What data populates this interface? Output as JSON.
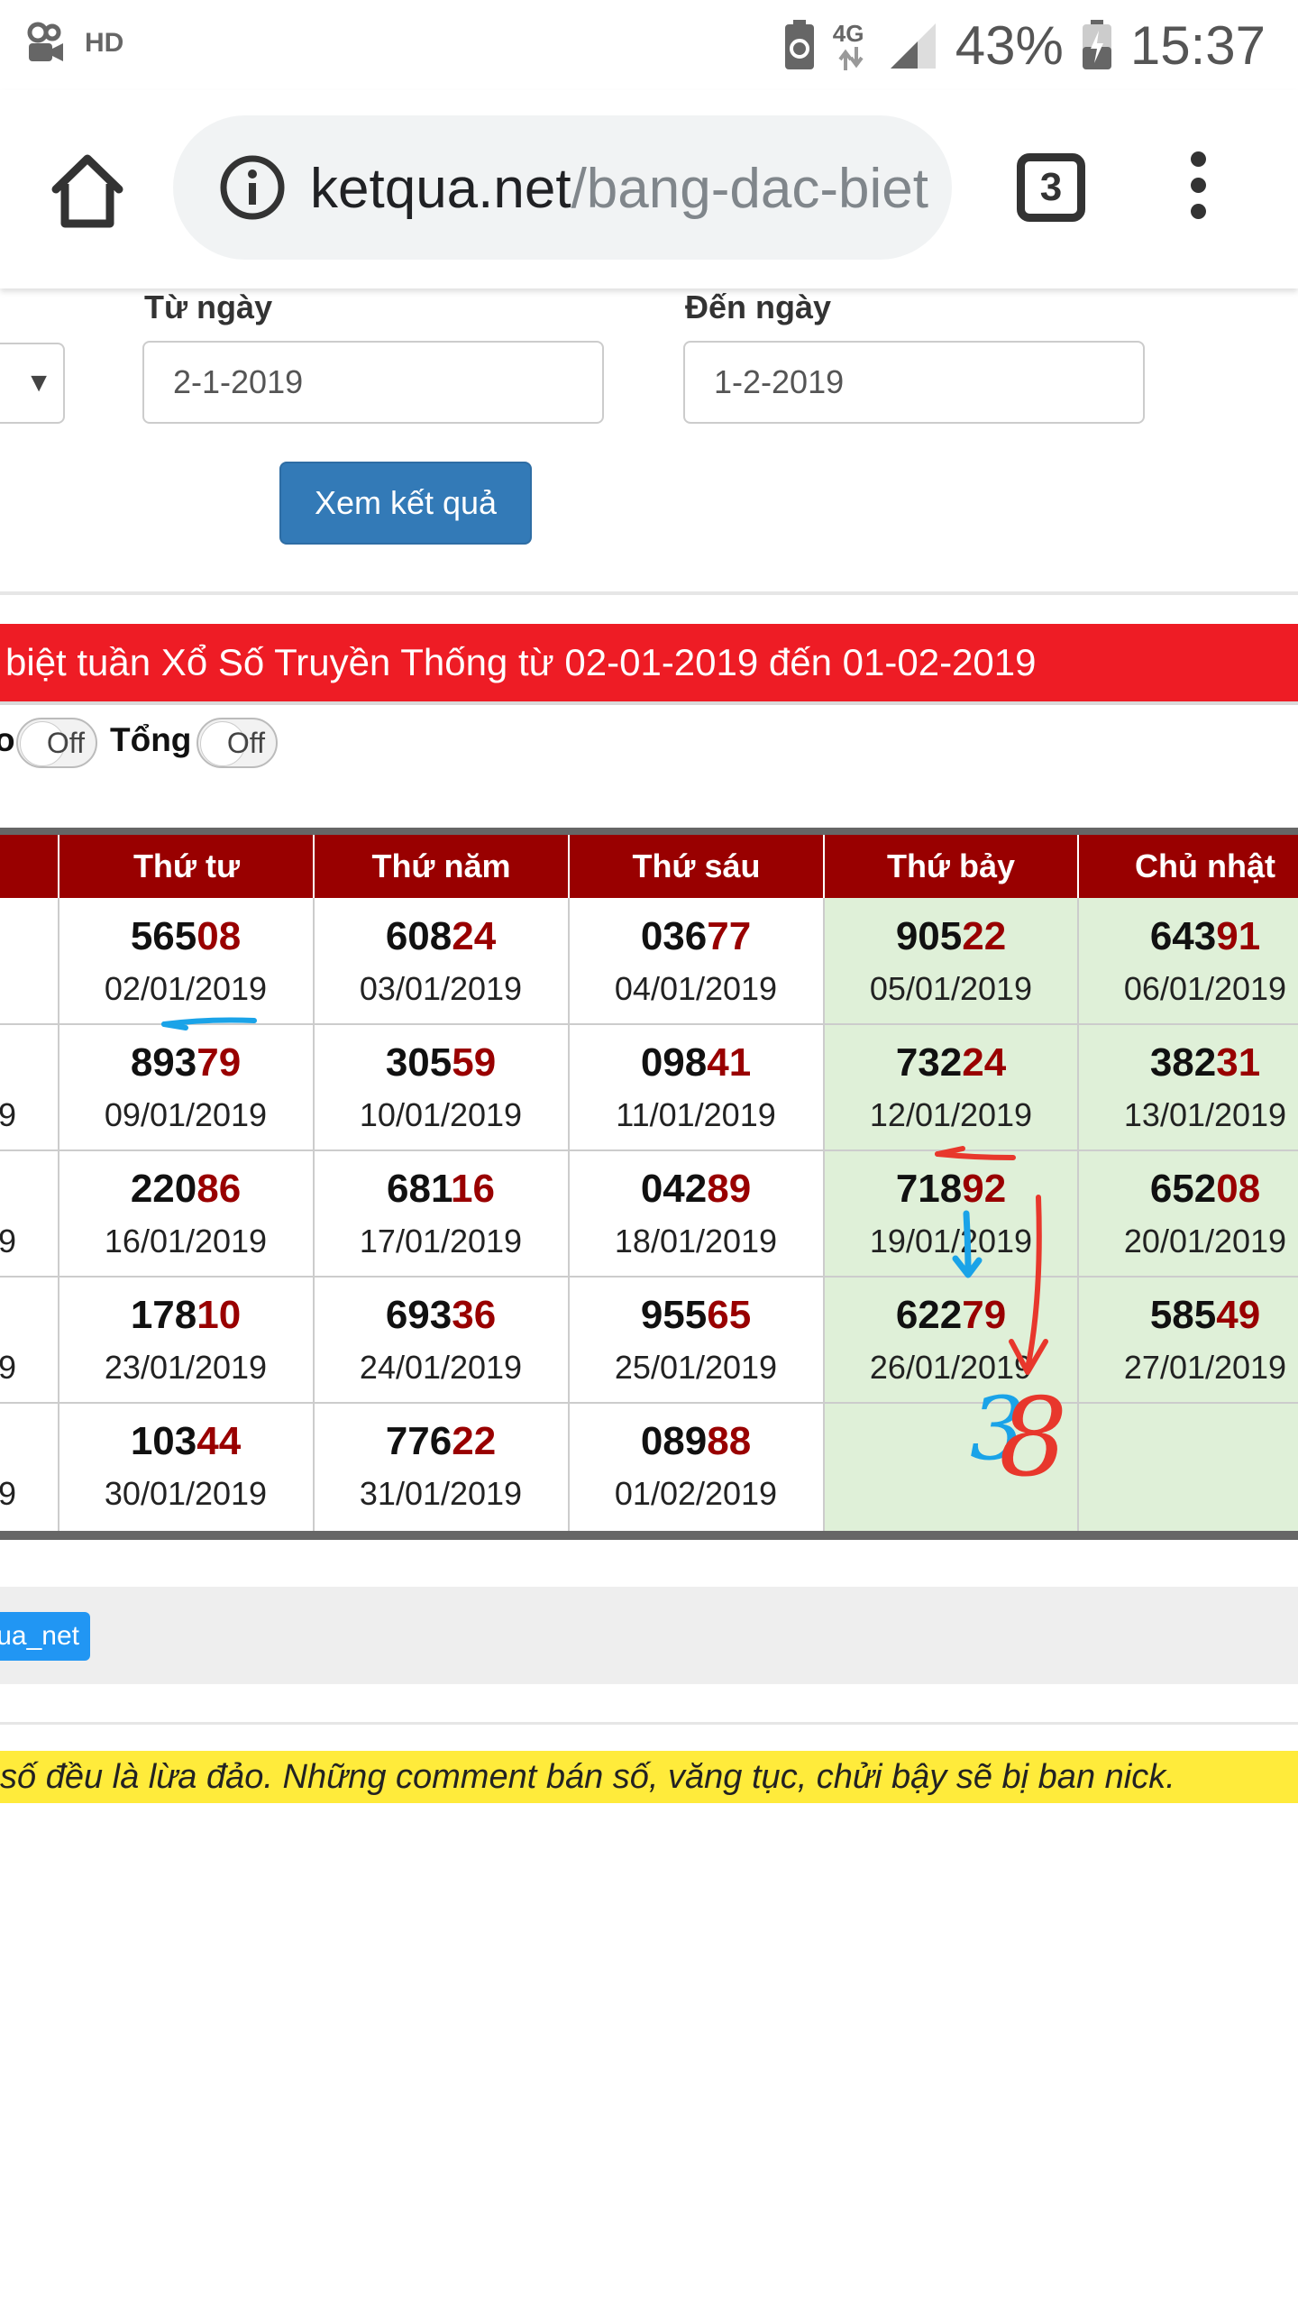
{
  "status_bar": {
    "hd_label": "HD",
    "network_label": "4G",
    "battery_percent": "43%",
    "time": "15:37",
    "icons": [
      "video-call-icon",
      "hd-voice-icon",
      "battery-saver-icon",
      "data-arrows-icon",
      "signal-icon",
      "battery-icon"
    ]
  },
  "browser": {
    "url_domain": "ketqua.net",
    "url_path": "/bang-dac-biet",
    "tab_count": "3",
    "icons": [
      "home-icon",
      "info-icon",
      "tab-switcher-icon",
      "more-vert-icon"
    ]
  },
  "form": {
    "from_label": "Từ ngày",
    "from_value": "2-1-2019",
    "to_label": "Đến ngày",
    "to_value": "1-2-2019",
    "submit_label": "Xem kết quả"
  },
  "title": "biệt tuần Xổ Số Truyền Thống từ 02-01-2019 đến 01-02-2019",
  "toggles": [
    {
      "label": "o",
      "state": "Off"
    },
    {
      "label": "Tổng",
      "state": "Off"
    }
  ],
  "table": {
    "headers": [
      "Thứ tư",
      "Thứ năm",
      "Thứ sáu",
      "Thứ bảy",
      "Chủ nhật"
    ],
    "partial_left_dates": [
      "9",
      "9",
      "9",
      "9"
    ],
    "rows": [
      [
        {
          "head": "565",
          "tail": "08",
          "date": "02/01/2019"
        },
        {
          "head": "608",
          "tail": "24",
          "date": "03/01/2019"
        },
        {
          "head": "036",
          "tail": "77",
          "date": "04/01/2019"
        },
        {
          "head": "905",
          "tail": "22",
          "date": "05/01/2019"
        },
        {
          "head": "643",
          "tail": "91",
          "date": "06/01/2019"
        }
      ],
      [
        {
          "head": "893",
          "tail": "79",
          "date": "09/01/2019"
        },
        {
          "head": "305",
          "tail": "59",
          "date": "10/01/2019"
        },
        {
          "head": "098",
          "tail": "41",
          "date": "11/01/2019"
        },
        {
          "head": "732",
          "tail": "24",
          "date": "12/01/2019"
        },
        {
          "head": "382",
          "tail": "31",
          "date": "13/01/2019"
        }
      ],
      [
        {
          "head": "220",
          "tail": "86",
          "date": "16/01/2019"
        },
        {
          "head": "681",
          "tail": "16",
          "date": "17/01/2019"
        },
        {
          "head": "042",
          "tail": "89",
          "date": "18/01/2019"
        },
        {
          "head": "718",
          "tail": "92",
          "date": "19/01/2019"
        },
        {
          "head": "652",
          "tail": "08",
          "date": "20/01/2019"
        }
      ],
      [
        {
          "head": "178",
          "tail": "10",
          "date": "23/01/2019"
        },
        {
          "head": "693",
          "tail": "36",
          "date": "24/01/2019"
        },
        {
          "head": "955",
          "tail": "65",
          "date": "25/01/2019"
        },
        {
          "head": "622",
          "tail": "79",
          "date": "26/01/2019"
        },
        {
          "head": "585",
          "tail": "49",
          "date": "27/01/2019"
        }
      ],
      [
        {
          "head": "103",
          "tail": "44",
          "date": "30/01/2019"
        },
        {
          "head": "776",
          "tail": "22",
          "date": "31/01/2019"
        },
        {
          "head": "089",
          "tail": "88",
          "date": "01/02/2019"
        },
        null,
        null
      ]
    ]
  },
  "annotation": {
    "handwritten_number_blue": "3",
    "handwritten_number_red": "8",
    "colors": {
      "blue": "#1aa3e8",
      "red": "#e8372c"
    }
  },
  "tag_button": "ua_net",
  "warning": "số đều là lừa đảo. Những comment bán số, văng tục, chửi bậy sẽ bị ban nick.",
  "colors": {
    "header_red": "#990000",
    "title_bar_red": "#ee1c25",
    "saturday_green": "#dff0d8",
    "button_blue": "#337ab7",
    "warning_yellow": "#ffeb3b"
  }
}
